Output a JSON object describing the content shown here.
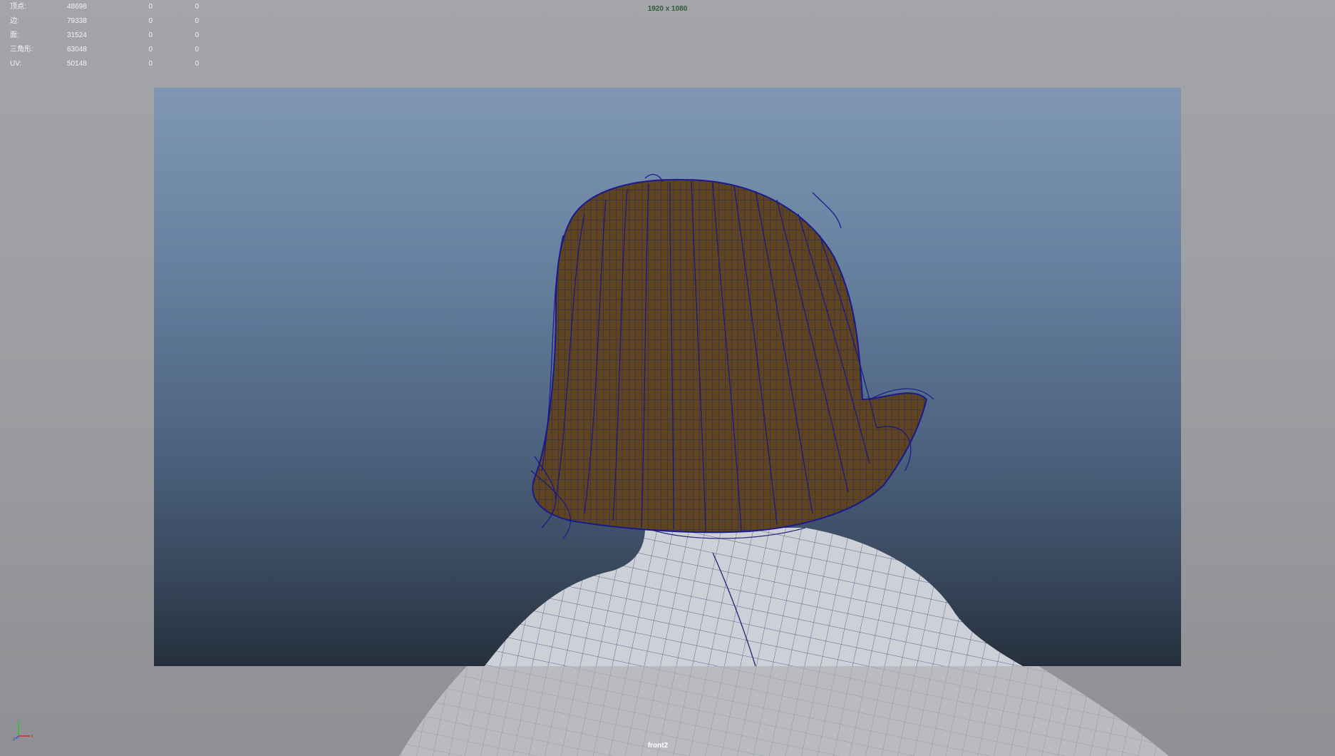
{
  "hud": {
    "rows": [
      {
        "label": "顶点:",
        "c1": "48698",
        "c2": "0",
        "c3": "0"
      },
      {
        "label": "边:",
        "c1": "79338",
        "c2": "0",
        "c3": "0"
      },
      {
        "label": "面:",
        "c1": "31524",
        "c2": "0",
        "c3": "0"
      },
      {
        "label": "三角形:",
        "c1": "63048",
        "c2": "0",
        "c3": "0"
      },
      {
        "label": "UV:",
        "c1": "50148",
        "c2": "0",
        "c3": "0"
      }
    ]
  },
  "resolution_label": "1920 x 1080",
  "camera_label": "front2",
  "axis_labels": {
    "x": "x",
    "y": "y",
    "z": "z"
  },
  "colors": {
    "wireframe": "#1a1a8c",
    "hair_fill": "#6b4a1e",
    "skin": "#c9cbd0",
    "axis_x": "#d22b2b",
    "axis_y": "#2fbf3a",
    "axis_z": "#2b55d2"
  }
}
